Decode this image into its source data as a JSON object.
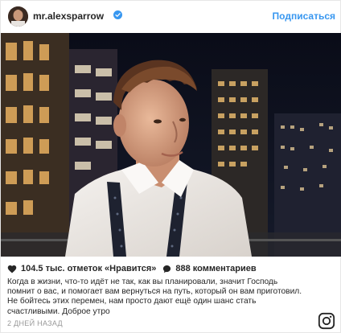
{
  "header": {
    "username": "mr.alexsparrow",
    "follow_label": "Подписаться"
  },
  "stats": {
    "likes": "104.5 тыс. отметок «Нравится»",
    "comments": "888 комментариев"
  },
  "caption": {
    "text": "Когда в жизни, что-то идёт не так, как вы планировали, значит Господь помнит о вас, и помогает вам вернуться на путь, который он вам приготовил. Не бойтесь этих перемен, нам просто дают ещё один шанс стать счастливыми. Доброе утро"
  },
  "timestamp": "2 ДНЕЙ НАЗАД",
  "icons": {
    "verified": "verified-badge-icon",
    "like": "heart-icon",
    "comment": "comment-bubble-icon",
    "brand": "instagram-logo-icon"
  },
  "colors": {
    "accent": "#3897f0",
    "text": "#262626",
    "muted": "#999999"
  }
}
